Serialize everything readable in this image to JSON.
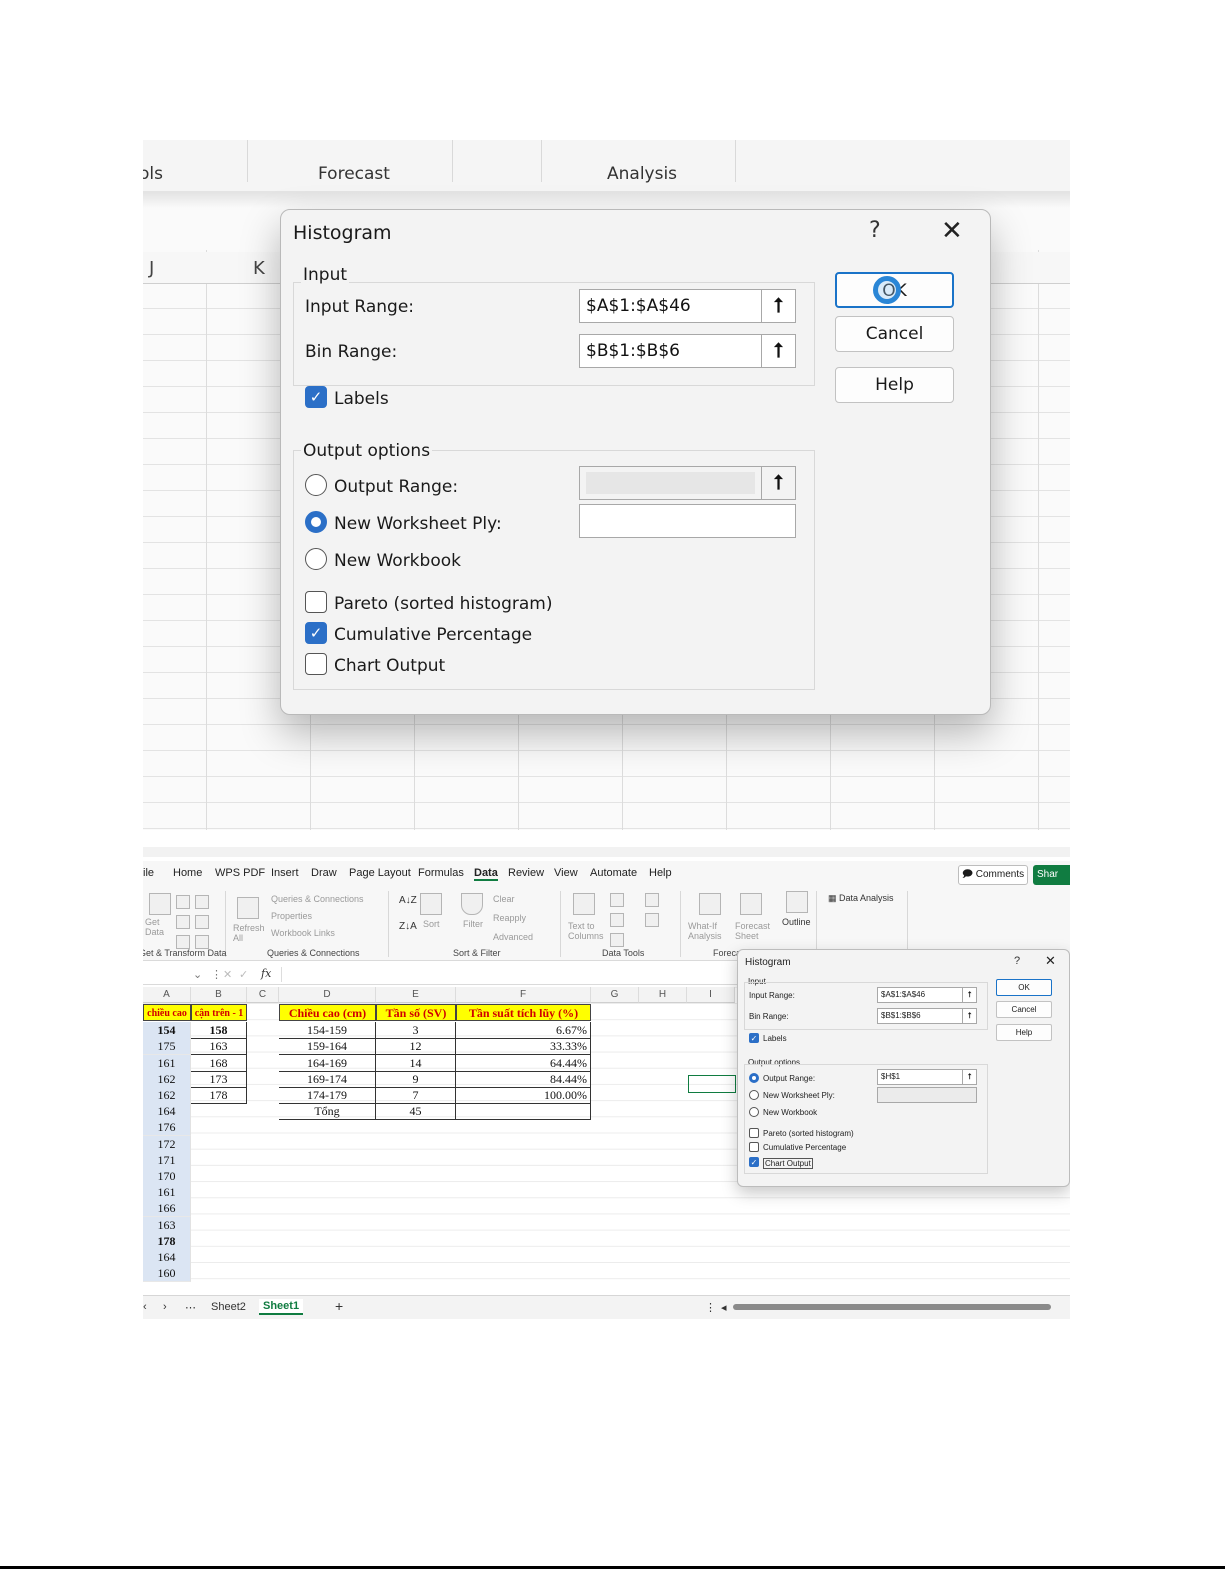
{
  "top_ribbon": {
    "groups": [
      "ols",
      "Forecast",
      "Analysis"
    ]
  },
  "top_columns": [
    "J",
    "K"
  ],
  "dialog_large": {
    "title": "Histogram",
    "help_glyph": "?",
    "close_glyph": "✕",
    "input_section": "Input",
    "input_range_label": "Input Range:",
    "input_range_value": "$A$1:$A$46",
    "bin_range_label": "Bin Range:",
    "bin_range_value": "$B$1:$B$6",
    "labels_label": "Labels",
    "output_section": "Output options",
    "output_range_label": "Output Range:",
    "output_range_value": "",
    "new_worksheet_label": "New Worksheet Ply:",
    "new_worksheet_value": "",
    "new_workbook_label": "New Workbook",
    "pareto_label": "Pareto (sorted histogram)",
    "cumulative_label": "Cumulative Percentage",
    "chart_output_label": "Chart Output",
    "ok_label": "OK",
    "cancel_label": "Cancel",
    "help_label": "Help",
    "state": {
      "labels": true,
      "output_choice": "new_worksheet",
      "pareto": false,
      "cumulative": true,
      "chart_output": false
    }
  },
  "excel": {
    "menu": [
      "ile",
      "Home",
      "WPS PDF",
      "Insert",
      "Draw",
      "Page Layout",
      "Formulas",
      "Data",
      "Review",
      "View",
      "Automate",
      "Help"
    ],
    "active_menu": "Data",
    "comments_label": "Comments",
    "share_label": "Shar",
    "ribbon": {
      "get_data": "Get Data",
      "queries_connections": "Queries & Connections",
      "properties": "Properties",
      "workbook_links": "Workbook Links",
      "refresh_all": "Refresh All",
      "sort": "Sort",
      "filter": "Filter",
      "clear": "Clear",
      "reapply": "Reapply",
      "advanced": "Advanced",
      "text_to_columns": "Text to Columns",
      "what_if": "What-If Analysis",
      "forecast_sheet": "Forecast Sheet",
      "outline": "Outline",
      "data_analysis": "Data Analysis",
      "groups": [
        "Get & Transform Data",
        "Queries & Connections",
        "Sort & Filter",
        "Data Tools",
        "Forecast"
      ]
    },
    "formula_symbol": "fx",
    "columns": [
      "A",
      "B",
      "C",
      "D",
      "E",
      "F",
      "G",
      "H",
      "I"
    ],
    "col_a_header": "chiều cao",
    "col_b_header": "cận trên - 1",
    "col_a": [
      "154",
      "175",
      "161",
      "162",
      "162",
      "164",
      "176",
      "172",
      "171",
      "170",
      "161",
      "166",
      "163",
      "178",
      "164",
      "160"
    ],
    "col_b": [
      "158",
      "163",
      "168",
      "173",
      "178"
    ],
    "table": {
      "headers": [
        "Chiều cao (cm)",
        "Tần số (SV)",
        "Tần suất tích lũy (%)"
      ],
      "rows": [
        [
          "154-159",
          "3",
          "6.67%"
        ],
        [
          "159-164",
          "12",
          "33.33%"
        ],
        [
          "164-169",
          "14",
          "64.44%"
        ],
        [
          "169-174",
          "9",
          "84.44%"
        ],
        [
          "174-179",
          "7",
          "100.00%"
        ]
      ],
      "total_label": "Tổng",
      "total_value": "45"
    },
    "sheet_tabs": [
      "Sheet2",
      "Sheet1"
    ],
    "active_tab": "Sheet1"
  },
  "dialog_small": {
    "title": "Histogram",
    "help_glyph": "?",
    "close_glyph": "✕",
    "input_section": "Input",
    "input_range_label": "Input Range:",
    "input_range_value": "$A$1:$A$46",
    "bin_range_label": "Bin Range:",
    "bin_range_value": "$B$1:$B$6",
    "labels_label": "Labels",
    "output_section": "Output options",
    "output_range_label": "Output Range:",
    "output_range_value": "$H$1",
    "new_worksheet_label": "New Worksheet Ply:",
    "new_workbook_label": "New Workbook",
    "pareto_label": "Pareto (sorted histogram)",
    "cumulative_label": "Cumulative Percentage",
    "chart_output_label": "Chart Output",
    "ok_label": "OK",
    "cancel_label": "Cancel",
    "help_label": "Help",
    "state": {
      "labels": true,
      "output_choice": "output_range",
      "pareto": false,
      "cumulative": false,
      "chart_output": true
    }
  }
}
